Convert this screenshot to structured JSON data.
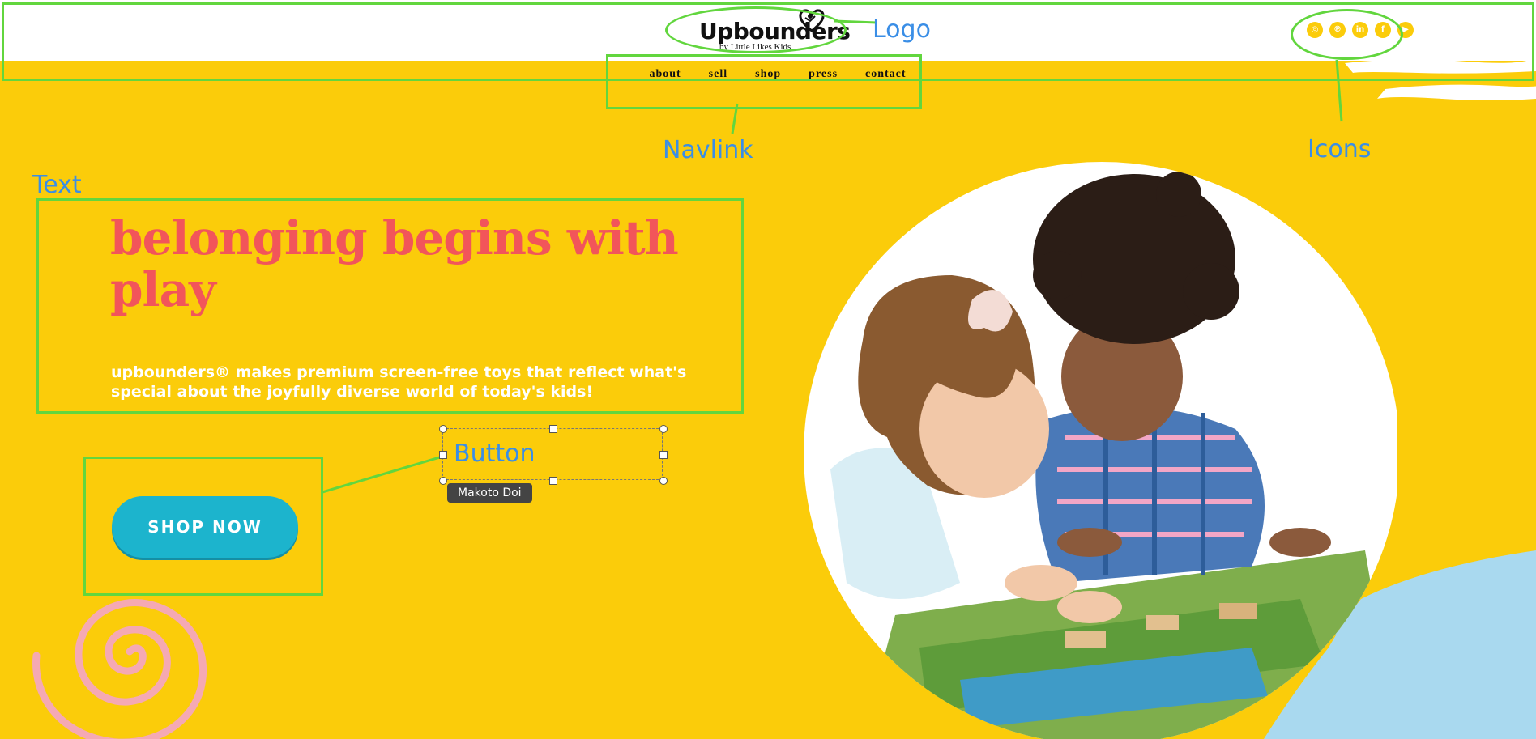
{
  "brand": {
    "logo_text": "Upbounders",
    "logo_subtitle": "by Little Likes Kids"
  },
  "nav": {
    "items": [
      "about",
      "sell",
      "shop",
      "press",
      "contact"
    ]
  },
  "social_icons": [
    "instagram-icon",
    "pinterest-icon",
    "linkedin-icon",
    "facebook-icon",
    "youtube-icon"
  ],
  "hero": {
    "headline": "belonging begins with play",
    "subtext": "upbounders® makes premium screen-free toys that reflect what's special about the joyfully diverse world of today's kids!",
    "cta_label": "SHOP NOW"
  },
  "annotations": {
    "logo": "Logo",
    "navlink": "Navlink",
    "icons": "Icons",
    "text": "Text",
    "button": "Button",
    "author": "Makoto Doi"
  },
  "colors": {
    "background": "#fbcc0a",
    "headline": "#f2555a",
    "cta": "#1cb4cd",
    "annotation_box": "#62d63e",
    "annotation_label": "#3a8ee6"
  }
}
